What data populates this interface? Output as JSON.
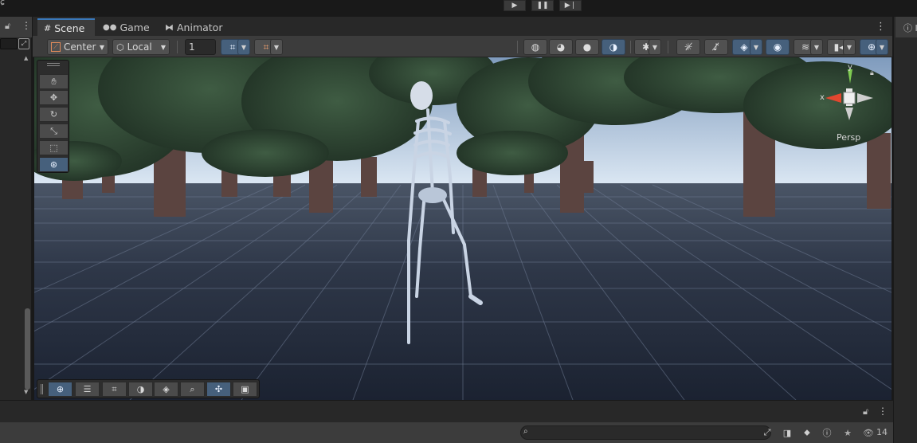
{
  "window": {
    "play_icons": [
      "play-icon",
      "pause-icon",
      "step-icon"
    ]
  },
  "tabs": [
    {
      "label": "Scene",
      "icon": "grid-icon",
      "active": true
    },
    {
      "label": "Game",
      "icon": "gamepad-icon",
      "active": false
    },
    {
      "label": "Animator",
      "icon": "animator-icon",
      "active": false
    }
  ],
  "toolbar": {
    "pivot_mode": "Center",
    "pivot_rotation": "Local",
    "grid_size": "1"
  },
  "scene": {
    "projection_label": "Persp",
    "gizmo_axes": {
      "x": "x",
      "y": "y"
    }
  },
  "tools": [
    "hand-tool-icon",
    "move-tool-icon",
    "rotate-tool-icon",
    "scale-tool-icon",
    "rect-tool-icon",
    "transform-tool-icon"
  ],
  "bottom_panel": {
    "visible_count": "14"
  },
  "colors": {
    "accent": "#46607c",
    "tab_highlight": "#3a79bb",
    "panel_bg": "#3c3c3c",
    "sky": "#b9cce0",
    "ground": "#2a3140"
  }
}
